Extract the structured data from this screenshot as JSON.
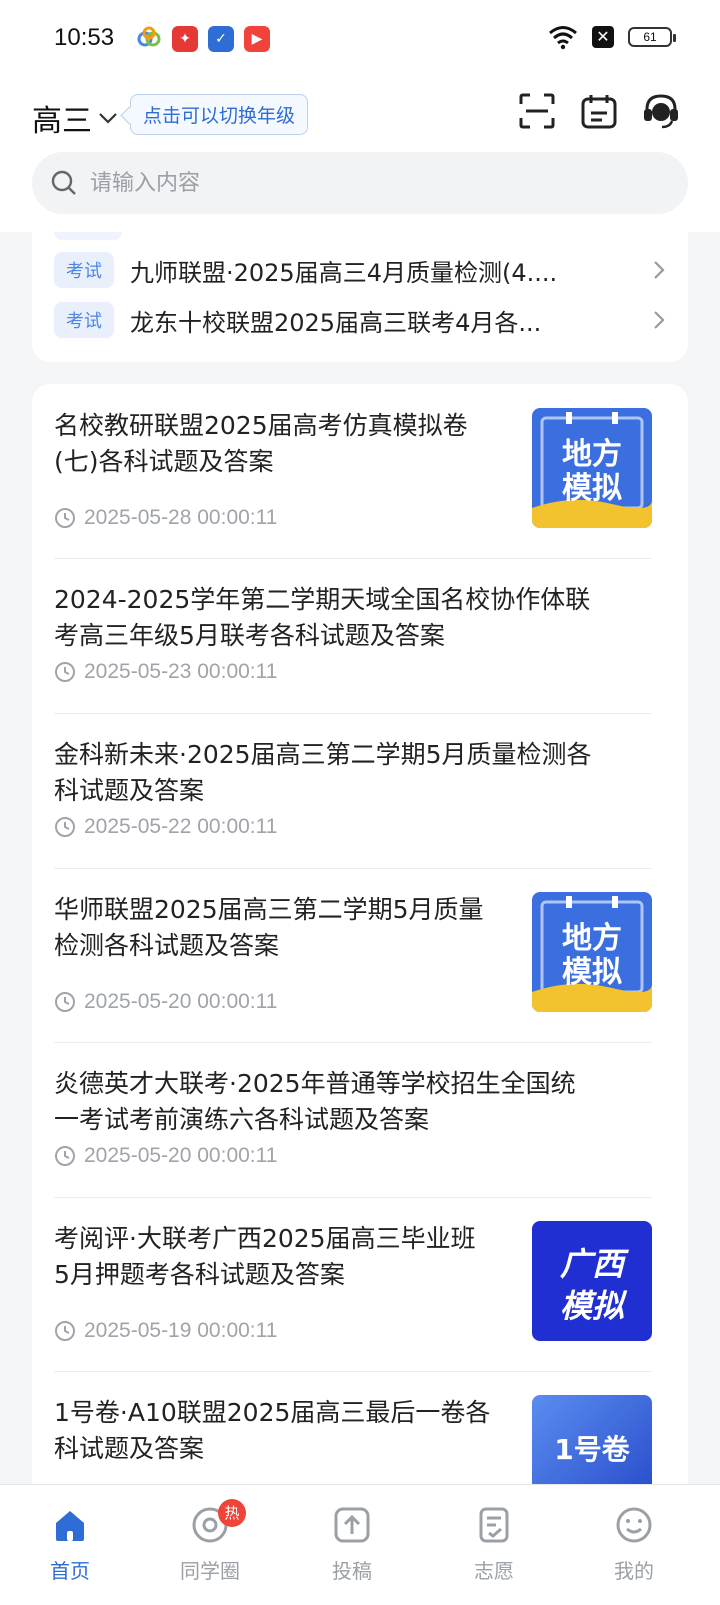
{
  "status_bar": {
    "time": "10:53",
    "battery": "61",
    "apps": [
      {
        "name": "colorful-app-icon",
        "color": "#4a86e8"
      },
      {
        "name": "red-news-app-icon",
        "color": "#e53935"
      },
      {
        "name": "blue-bird-app-icon",
        "color": "#2f6dd6"
      },
      {
        "name": "video-play-app-icon",
        "color": "#f2433a"
      }
    ]
  },
  "header": {
    "grade": "高三",
    "grade_tip": "点击可以切换年级"
  },
  "search": {
    "placeholder": "请输入内容"
  },
  "exam_list": [
    {
      "tag": "考试",
      "title": "九师联盟·2025届高三4月质量检测(4...."
    },
    {
      "tag": "考试",
      "title": "龙东十校联盟2025届高三联考4月各..."
    }
  ],
  "articles": [
    {
      "title_line1": "名校教研联盟2025届高考仿真模拟卷",
      "title_line2": "(七)各科试题及答案",
      "date": "2025-05-28 00:00:11",
      "thumb": {
        "line1": "地方",
        "line2": "模拟",
        "style": "difang"
      }
    },
    {
      "title_line1": "2024-2025学年第二学期天域全国名校协作体联",
      "title_line2": "考高三年级5月联考各科试题及答案",
      "date": "2025-05-23 00:00:11"
    },
    {
      "title_line1": "金科新未来·2025届高三第二学期5月质量检测各",
      "title_line2": "科试题及答案",
      "date": "2025-05-22 00:00:11"
    },
    {
      "title_line1": "华师联盟2025届高三第二学期5月质量",
      "title_line2": "检测各科试题及答案",
      "date": "2025-05-20 00:00:11",
      "thumb": {
        "line1": "地方",
        "line2": "模拟",
        "style": "difang"
      }
    },
    {
      "title_line1": "炎德英才大联考·2025年普通等学校招生全国统",
      "title_line2": "一考试考前演练六各科试题及答案",
      "date": "2025-05-20 00:00:11"
    },
    {
      "title_line1": "考阅评·大联考广西2025届高三毕业班",
      "title_line2": "5月押题考各科试题及答案",
      "date": "2025-05-19 00:00:11",
      "thumb": {
        "line1": "广西",
        "line2": "模拟",
        "style": "guangxi"
      }
    },
    {
      "title_line1": "1号卷·A10联盟2025届高三最后一卷各",
      "title_line2": "科试题及答案",
      "date": "",
      "thumb": {
        "line1": "",
        "line2": "1号卷",
        "style": "yihao"
      }
    }
  ],
  "bottom_nav": [
    {
      "label": "首页",
      "icon": "home-icon",
      "active": true
    },
    {
      "label": "同学圈",
      "icon": "circle-icon",
      "badge": "热"
    },
    {
      "label": "投稿",
      "icon": "upload-icon"
    },
    {
      "label": "志愿",
      "icon": "clipboard-check-icon"
    },
    {
      "label": "我的",
      "icon": "smiley-face-icon"
    }
  ],
  "colors": {
    "accent": "#2f6dd6",
    "tag_bg": "#e9f0fc",
    "badge": "#f04438",
    "thumb_blue": "#3b6fe0",
    "thumb_yellow": "#f2c22f"
  }
}
